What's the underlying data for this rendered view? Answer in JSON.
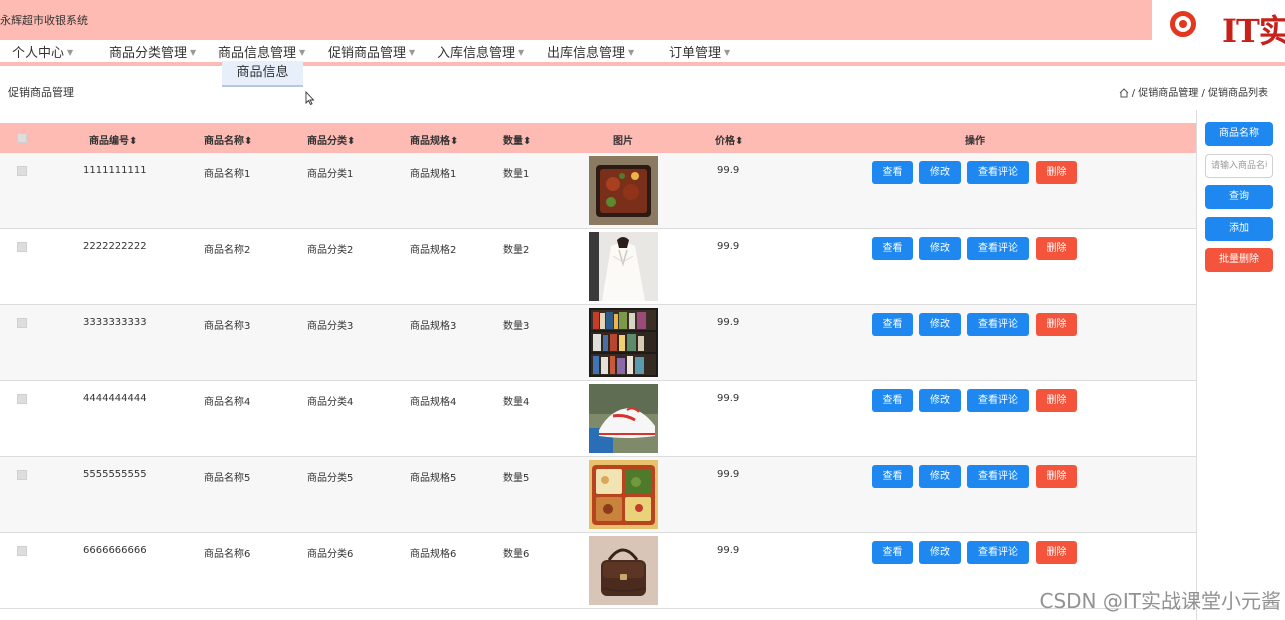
{
  "app": {
    "title": "永辉超市收银系统"
  },
  "logo": {
    "text": "IT实"
  },
  "nav": {
    "items": [
      {
        "label": "个人中心"
      },
      {
        "label": "商品分类管理"
      },
      {
        "label": "商品信息管理"
      },
      {
        "label": "促销商品管理"
      },
      {
        "label": "入库信息管理"
      },
      {
        "label": "出库信息管理"
      },
      {
        "label": "订单管理"
      }
    ]
  },
  "dropdown": {
    "item": "商品信息"
  },
  "page": {
    "heading": "促销商品管理"
  },
  "breadcrumb": {
    "item1": "促销商品管理",
    "item2": "促销商品列表",
    "separator": "/"
  },
  "table": {
    "headers": {
      "code": "商品编号",
      "name": "商品名称",
      "category": "商品分类",
      "spec": "商品规格",
      "quantity": "数量",
      "image": "图片",
      "price": "价格",
      "actions": "操作"
    },
    "sort_icon": "sort-arrows-icon",
    "rows": [
      {
        "code": "1111111111",
        "name": "商品名称1",
        "category": "商品分类1",
        "spec": "商品规格1",
        "quantity": "数量1",
        "price": "99.9",
        "image": "food-box-photo"
      },
      {
        "code": "2222222222",
        "name": "商品名称2",
        "category": "商品分类2",
        "spec": "商品规格2",
        "quantity": "数量2",
        "price": "99.9",
        "image": "white-blouse-photo"
      },
      {
        "code": "3333333333",
        "name": "商品名称3",
        "category": "商品分类3",
        "spec": "商品规格3",
        "quantity": "数量3",
        "price": "99.9",
        "image": "bookshelf-photo"
      },
      {
        "code": "4444444444",
        "name": "商品名称4",
        "category": "商品分类4",
        "spec": "商品规格4",
        "quantity": "数量4",
        "price": "99.9",
        "image": "sneaker-photo"
      },
      {
        "code": "5555555555",
        "name": "商品名称5",
        "category": "商品分类5",
        "spec": "商品规格5",
        "quantity": "数量5",
        "price": "99.9",
        "image": "bento-photo"
      },
      {
        "code": "6666666666",
        "name": "商品名称6",
        "category": "商品分类6",
        "spec": "商品规格6",
        "quantity": "数量6",
        "price": "99.9",
        "image": "handbag-photo"
      }
    ]
  },
  "actions": {
    "view": "查看",
    "edit": "修改",
    "review": "查看评论",
    "delete": "删除"
  },
  "sidebar": {
    "label_button": "商品名称",
    "search_placeholder": "请输入商品名称",
    "query": "查询",
    "add": "添加",
    "batch_delete": "批量删除"
  },
  "watermark": {
    "text": "CSDN @IT实战课堂小元酱"
  },
  "colors": {
    "header_pink": "#fdbbb3",
    "primary_blue": "#1e88f0",
    "danger_red": "#f5543c",
    "logo_red": "#c8201b"
  }
}
